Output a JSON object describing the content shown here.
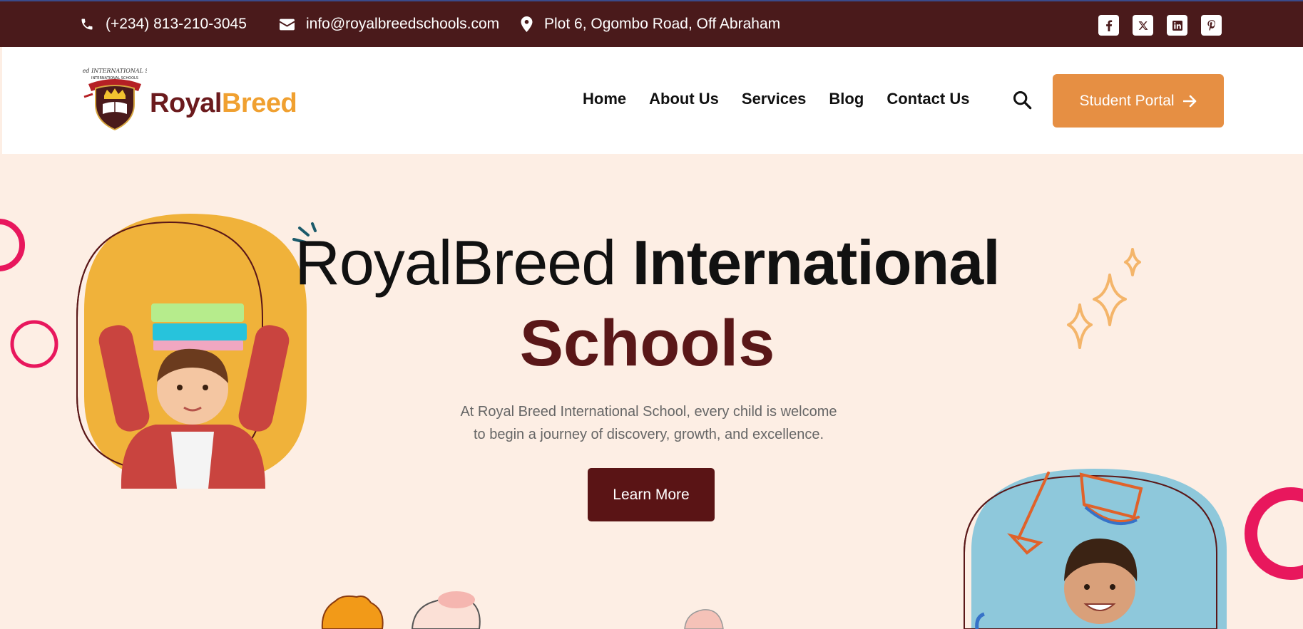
{
  "topbar": {
    "phone": "(+234) 813-210-3045",
    "email": "info@royalbreedschools.com",
    "address": "Plot 6, Ogombo Road, Off Abraham",
    "socials": [
      "facebook-icon",
      "x-icon",
      "linkedin-icon",
      "pinterest-icon"
    ]
  },
  "header": {
    "logo_part1": "Royal",
    "logo_part2": "Breed",
    "logo_seal": "Royal Breed INTERNATIONAL SCHOOLS",
    "nav": [
      "Home",
      "About Us",
      "Services",
      "Blog",
      "Contact Us"
    ],
    "portal_label": "Student Portal"
  },
  "hero": {
    "title_light": "RoyalBreed ",
    "title_bold": "International",
    "title_line2": "Schools",
    "desc_line1": "At Royal Breed International School, every child is welcome",
    "desc_line2": "to begin a journey of discovery, growth, and excellence.",
    "cta_label": "Learn More"
  },
  "colors": {
    "topbar": "#4a1a1b",
    "accent": "#e68f43",
    "brand_dark": "#5a1415",
    "hero_bg": "#fdeee4",
    "decor_pink": "#e8175d"
  }
}
